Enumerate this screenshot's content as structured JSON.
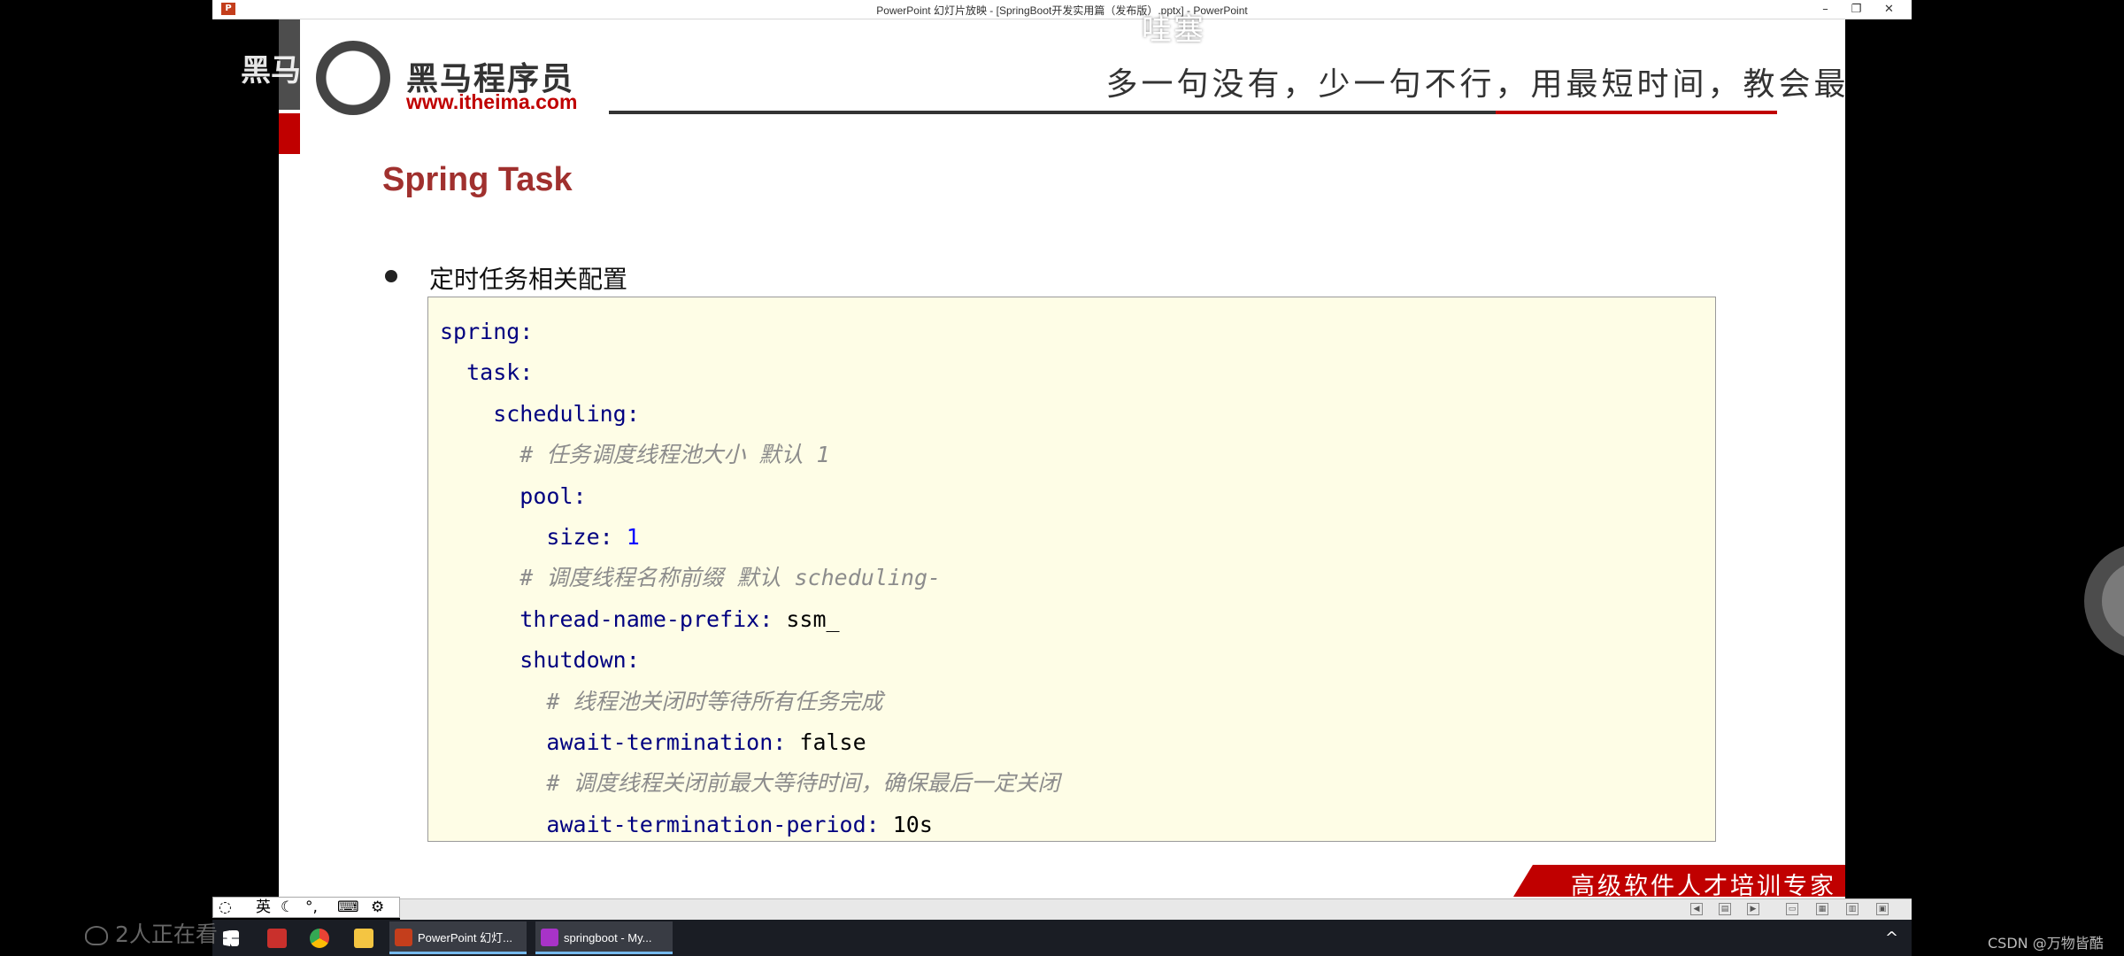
{
  "window": {
    "app_icon": "P",
    "title": "PowerPoint 幻灯片放映 - [SpringBoot开发实用篇（发布版）.pptx] - PowerPoint",
    "min": "–",
    "max": "❐",
    "close": "✕"
  },
  "overlay": {
    "top_center": "哇塞",
    "left": "黑马"
  },
  "slide": {
    "logo_text": "黑马程序员",
    "logo_url": "www.itheima.com",
    "slogan": "多一句没有，少一句不行，用最短时间，教会最实用的技术!",
    "heading": "Spring Task",
    "bullet": "定时任务相关配置",
    "code_lines": [
      {
        "type": "key",
        "text": "spring:"
      },
      {
        "type": "key",
        "text": "  task:"
      },
      {
        "type": "key",
        "text": "    scheduling:"
      },
      {
        "type": "comment",
        "text": "      # 任务调度线程池大小 默认 1"
      },
      {
        "type": "key",
        "text": "      pool:"
      },
      {
        "type": "kv",
        "key": "        size: ",
        "val": "1",
        "num": true
      },
      {
        "type": "comment",
        "text": "      # 调度线程名称前缀 默认 scheduling-"
      },
      {
        "type": "kv",
        "key": "      thread-name-prefix: ",
        "val": "ssm_"
      },
      {
        "type": "key",
        "text": "      shutdown:"
      },
      {
        "type": "comment",
        "text": "        # 线程池关闭时等待所有任务完成"
      },
      {
        "type": "kv",
        "key": "        await-termination: ",
        "val": "false"
      },
      {
        "type": "comment",
        "text": "        # 调度线程关闭前最大等待时间，确保最后一定关闭"
      },
      {
        "type": "kv",
        "key": "        await-termination-period: ",
        "val": "10s"
      }
    ],
    "banner": "高级软件人才培训专家"
  },
  "ime": {
    "swirl": "◌",
    "lang": "英",
    "moon": "☾",
    "punct": "°,",
    "keyboard": "⌨",
    "gear": "⚙"
  },
  "taskbar": {
    "tasks": [
      {
        "label": "PowerPoint 幻灯...",
        "color": "#c43e1c"
      },
      {
        "label": "springboot - My...",
        "color": "#a833c8"
      }
    ],
    "chevron": "^"
  },
  "viewers": "2人正在看",
  "csdn": "CSDN @万物皆酷",
  "colors": {
    "heading": "#a0302e",
    "accent_red": "#c00000",
    "code_bg": "#fefde6",
    "code_key": "#000080"
  }
}
